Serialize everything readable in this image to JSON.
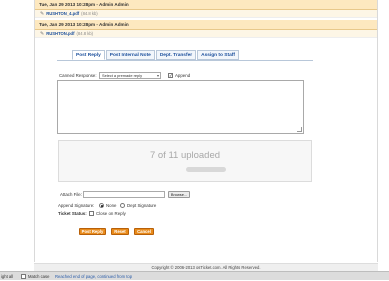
{
  "thread": [
    {
      "header": "Tue, Jan 29 2013 10:28pm - Admin Admin",
      "file": "RUSHTON_4.pdf",
      "size": "(84.8 kb)"
    },
    {
      "header": "Tue, Jan 29 2013 10:28pm - Admin Admin",
      "file": "RUSHTON.pdf",
      "size": "(84.8 kb)"
    }
  ],
  "tabs": [
    "Post Reply",
    "Post Internal Note",
    "Dept. Transfer",
    "Assign to Staff"
  ],
  "reply": {
    "canned_label": "Canned Response:",
    "canned_value": "Select a premade reply",
    "append_label": "Append",
    "upload_status": "7 of 11 uploaded",
    "upload_progress": 0.64,
    "attach_label": "Attach File:",
    "browse_label": "Browse...",
    "signature_label": "Append Signature:",
    "sig_none": "None",
    "sig_dept": "Dept Signature",
    "status_label": "Ticket Status:",
    "close_label": "Close on Reply"
  },
  "buttons": {
    "post": "Post Reply",
    "reset": "Reset",
    "cancel": "Cancel"
  },
  "footer": {
    "copyright": "Copyright © 2006-2013 osTicket.com.  All Rights Reserved."
  },
  "findbar": {
    "highlight": "ight all",
    "match_case": "Match case",
    "message": "Reached end of page, continued from top"
  },
  "colors": {
    "header_bg": "#fde8bf",
    "accent_orange": "#e88a1a",
    "link_blue": "#1b4f9c"
  }
}
